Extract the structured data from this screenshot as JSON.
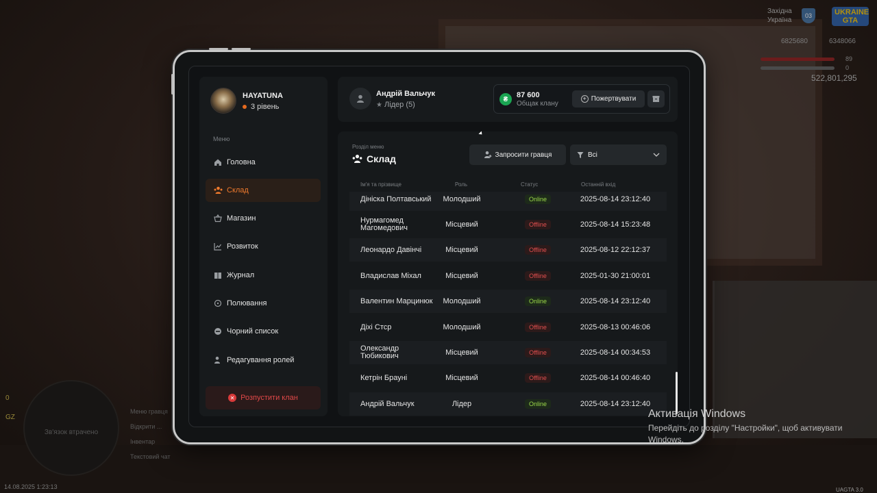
{
  "hud": {
    "region_line1": "Західна",
    "region_line2": "Україна",
    "region_badge": "03",
    "logo_line1": "UKRAINE",
    "logo_line2": "GTA",
    "money_left": "6825680",
    "money_right": "6348066",
    "hp_value": "89",
    "armor_value": "0",
    "cash": "522,801,295",
    "minimap_text": "Зв'язок втрачено",
    "left_icons": [
      "0",
      "GZ"
    ],
    "menu_hints": [
      "Меню гравця",
      "Відкрити ...",
      "Інвентар",
      "Текстовий чат"
    ],
    "datetime": "14.08.2025 1:23:13",
    "version": "UAGTA 3.0"
  },
  "windows_activation": {
    "title": "Активація Windows",
    "text": "Перейдіть до розділу \"Настройки\", щоб активувати Windows."
  },
  "profile": {
    "name": "HAYATUNA",
    "level": "3 рівень"
  },
  "menu": {
    "caption": "Меню",
    "items": [
      {
        "label": "Головна",
        "icon": "home-icon"
      },
      {
        "label": "Склад",
        "icon": "users-icon",
        "active": true
      },
      {
        "label": "Магазин",
        "icon": "basket-icon"
      },
      {
        "label": "Розвиток",
        "icon": "chart-icon"
      },
      {
        "label": "Журнал",
        "icon": "book-icon"
      },
      {
        "label": "Полювання",
        "icon": "target-icon"
      },
      {
        "label": "Чорний список",
        "icon": "block-icon"
      },
      {
        "label": "Редагування ролей",
        "icon": "user-edit-icon"
      }
    ],
    "disband_label": "Розпустити клан"
  },
  "header": {
    "user_name": "Андрій Вальчук",
    "user_role": "Лідер (5)",
    "balance_value": "87 600",
    "balance_label": "Общак клану",
    "donate_label": "Пожертвувати",
    "coin_symbol": "₴"
  },
  "section": {
    "caption": "Розділ меню",
    "title": "Склад",
    "invite_label": "Запросити гравця",
    "filter_value": "Всі"
  },
  "table": {
    "headers": [
      "Ім'я та прізвище",
      "Роль",
      "Статус",
      "Останній вхід"
    ],
    "rows": [
      {
        "name": "Дініска Полтавський",
        "role": "Молодший",
        "status": "Online",
        "last": "2025-08-14 23:12:40"
      },
      {
        "name": "Нурмагомед Магомедович",
        "role": "Місцевий",
        "status": "Offline",
        "last": "2025-08-14 15:23:48"
      },
      {
        "name": "Леонардо Давінчі",
        "role": "Місцевий",
        "status": "Offline",
        "last": "2025-08-12 22:12:37"
      },
      {
        "name": "Владислав Міхал",
        "role": "Місцевий",
        "status": "Offline",
        "last": "2025-01-30 21:00:01"
      },
      {
        "name": "Валентин Марцинюк",
        "role": "Молодший",
        "status": "Online",
        "last": "2025-08-14 23:12:40"
      },
      {
        "name": "Діхі Стср",
        "role": "Молодший",
        "status": "Offline",
        "last": "2025-08-13 00:46:06"
      },
      {
        "name": "Олександр Тюбикович",
        "role": "Місцевий",
        "status": "Offline",
        "last": "2025-08-14 00:34:53"
      },
      {
        "name": "Кетрін Брауні",
        "role": "Місцевий",
        "status": "Offline",
        "last": "2025-08-14 00:46:40"
      },
      {
        "name": "Андрій Вальчук",
        "role": "Лідер",
        "status": "Online",
        "last": "2025-08-14 23:12:40"
      }
    ]
  }
}
